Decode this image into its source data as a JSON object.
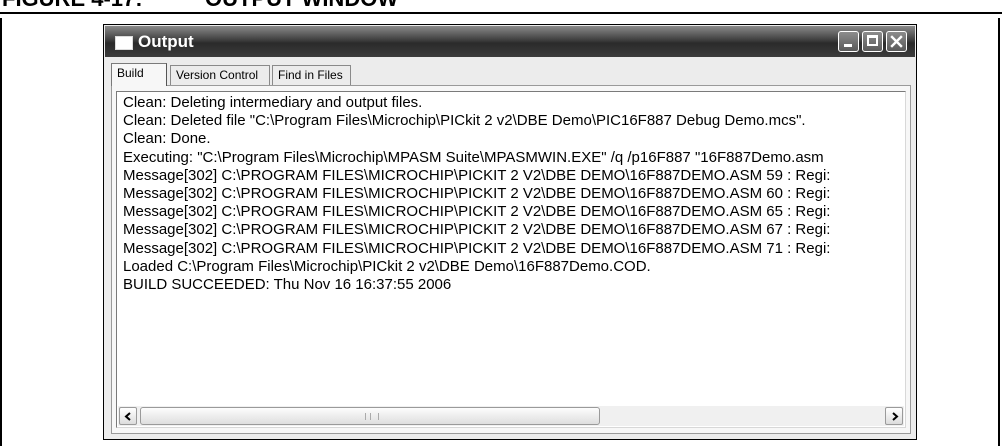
{
  "figure": {
    "number": "FIGURE 4-17:",
    "title": "OUTPUT WINDOW"
  },
  "window": {
    "title": "Output",
    "icon": "window-app-icon",
    "controls": [
      "minimize-icon",
      "maximize-icon",
      "close-icon"
    ]
  },
  "tabs": [
    {
      "label": "Build",
      "active": true
    },
    {
      "label": "Version Control",
      "active": false
    },
    {
      "label": "Find in Files",
      "active": false
    }
  ],
  "log_lines": [
    "Clean: Deleting intermediary and output files.",
    "Clean: Deleted file \"C:\\Program Files\\Microchip\\PICkit 2 v2\\DBE Demo\\PIC16F887 Debug Demo.mcs\".",
    "Clean: Done.",
    "Executing: \"C:\\Program Files\\Microchip\\MPASM Suite\\MPASMWIN.EXE\" /q /p16F887 \"16F887Demo.asm",
    "Message[302] C:\\PROGRAM FILES\\MICROCHIP\\PICKIT 2 V2\\DBE DEMO\\16F887DEMO.ASM 59 : Regi:",
    "Message[302] C:\\PROGRAM FILES\\MICROCHIP\\PICKIT 2 V2\\DBE DEMO\\16F887DEMO.ASM 60 : Regi:",
    "Message[302] C:\\PROGRAM FILES\\MICROCHIP\\PICKIT 2 V2\\DBE DEMO\\16F887DEMO.ASM 65 : Regi:",
    "Message[302] C:\\PROGRAM FILES\\MICROCHIP\\PICKIT 2 V2\\DBE DEMO\\16F887DEMO.ASM 67 : Regi:",
    "Message[302] C:\\PROGRAM FILES\\MICROCHIP\\PICKIT 2 V2\\DBE DEMO\\16F887DEMO.ASM 71 : Regi:",
    "Loaded C:\\Program Files\\Microchip\\PICkit 2 v2\\DBE Demo\\16F887Demo.COD.",
    "BUILD SUCCEEDED: Thu Nov 16 16:37:55 2006"
  ],
  "scrollbar": {
    "horizontal_position": 0.0,
    "left_arrow_icon": "chevron-left-icon",
    "right_arrow_icon": "chevron-right-icon"
  },
  "colors": {
    "titlebar": "#3c3c3c",
    "title_text": "#ffffff",
    "log_background": "#ffffff"
  }
}
